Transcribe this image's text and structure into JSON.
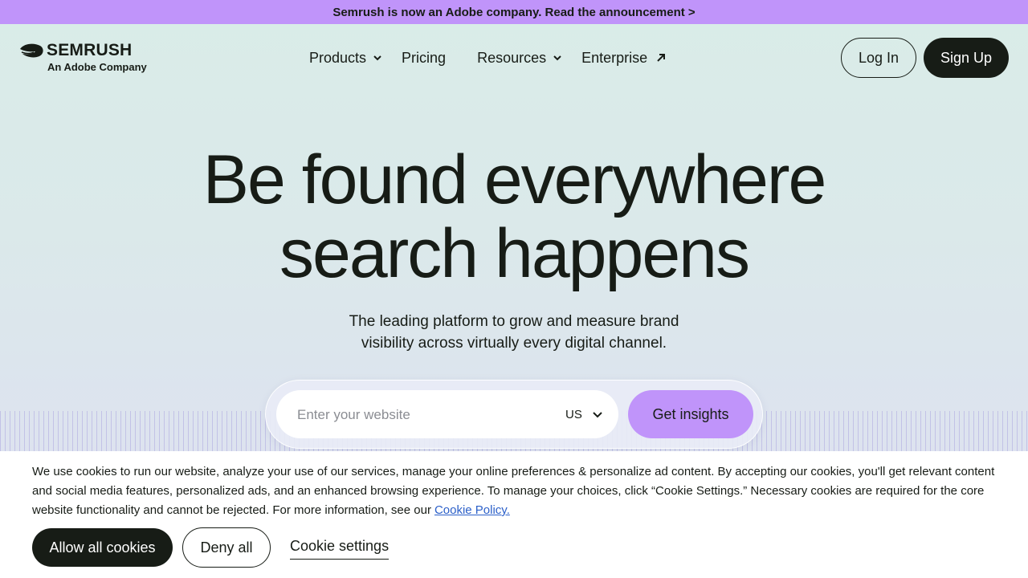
{
  "banner": {
    "text": "Semrush is now an Adobe company. Read the announcement >"
  },
  "header": {
    "logo_text": "SEMRUSH",
    "logo_subtext": "An Adobe Company",
    "nav": [
      {
        "label": "Products",
        "icon": "chevron-down-icon"
      },
      {
        "label": "Pricing"
      },
      {
        "label": "Resources",
        "icon": "chevron-down-icon"
      },
      {
        "label": "Enterprise",
        "icon": "external-arrow-icon"
      }
    ],
    "login_label": "Log In",
    "signup_label": "Sign Up"
  },
  "hero": {
    "title_line1": "Be found everywhere",
    "title_line2": "search happens",
    "subtitle_line1": "The leading platform to grow and measure brand",
    "subtitle_line2": "visibility across virtually every digital channel."
  },
  "search": {
    "value": "",
    "placeholder": "Enter your website",
    "country": "US",
    "button_label": "Get insights"
  },
  "cookie": {
    "text": "We use cookies to run our website, analyze your use of our services, manage your online preferences & personalize ad content. By accepting our cookies, you'll get relevant content and social media features, personalized ads, and an enhanced browsing experience. To manage your choices, click “Cookie Settings.” Necessary cookies are required for the core website functionality and cannot be rejected. For more information, see our",
    "link_label": "Cookie Policy.",
    "allow_label": "Allow all cookies",
    "deny_label": "Deny all",
    "settings_label": "Cookie settings"
  },
  "colors": {
    "accent": "#c094fa",
    "dark": "#171c16",
    "link": "#2c60c9"
  }
}
